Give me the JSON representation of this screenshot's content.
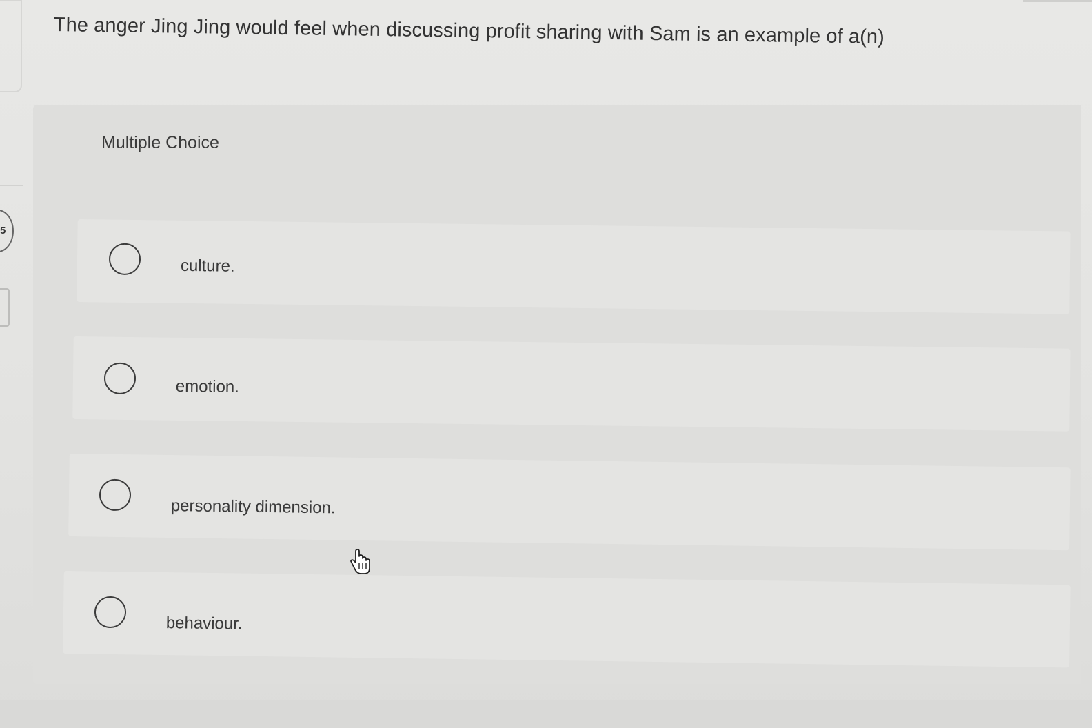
{
  "question": {
    "text": "The anger Jing Jing would feel when discussing profit sharing with Sam is an example of a(n)"
  },
  "question_type": "Multiple Choice",
  "options": [
    {
      "label": "culture.",
      "selected": false
    },
    {
      "label": "emotion.",
      "selected": false
    },
    {
      "label": "personality dimension.",
      "selected": false
    },
    {
      "label": "behaviour.",
      "selected": false
    }
  ],
  "left_edge": {
    "badge_text": "5"
  },
  "cursor": {
    "icon": "hand-pointer-icon"
  }
}
